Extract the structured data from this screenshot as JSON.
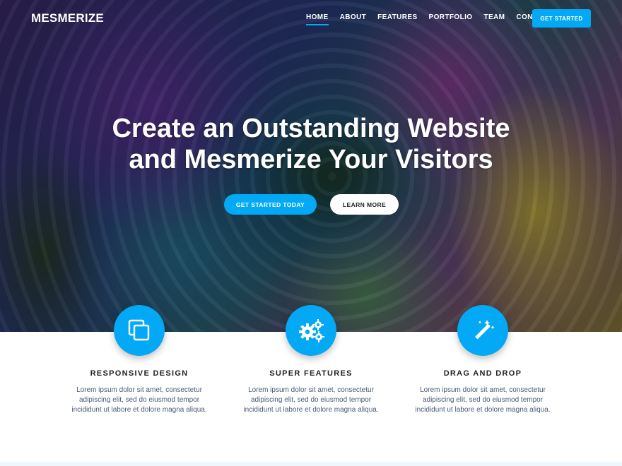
{
  "brand": {
    "logo": "MESMERIZE"
  },
  "nav": {
    "items": [
      {
        "label": "HOME",
        "active": true
      },
      {
        "label": "ABOUT"
      },
      {
        "label": "FEATURES"
      },
      {
        "label": "PORTFOLIO"
      },
      {
        "label": "TEAM"
      },
      {
        "label": "CONTACT"
      }
    ],
    "cta": "GET STARTED"
  },
  "hero": {
    "headline_line1": "Create an Outstanding Website",
    "headline_line2": "and Mesmerize Your Visitors",
    "primary_button": "GET STARTED TODAY",
    "secondary_button": "LEARN MORE"
  },
  "features": [
    {
      "icon": "copy-icon",
      "title": "RESPONSIVE DESIGN",
      "text": "Lorem ipsum dolor sit amet, consectetur adipiscing elit, sed do eiusmod tempor incididunt ut labore et dolore magna aliqua."
    },
    {
      "icon": "gears-icon",
      "title": "SUPER FEATURES",
      "text": "Lorem ipsum dolor sit amet, consectetur adipiscing elit, sed do eiusmod tempor incididunt ut labore et dolore magna aliqua."
    },
    {
      "icon": "magic-wand-icon",
      "title": "DRAG AND DROP",
      "text": "Lorem ipsum dolor sit amet, consectetur adipiscing elit, sed do eiusmod tempor incididunt ut labore et dolore magna aliqua."
    }
  ],
  "colors": {
    "accent": "#03a9f4",
    "text_dark": "#222222",
    "text_muted": "#4a5a7a"
  }
}
